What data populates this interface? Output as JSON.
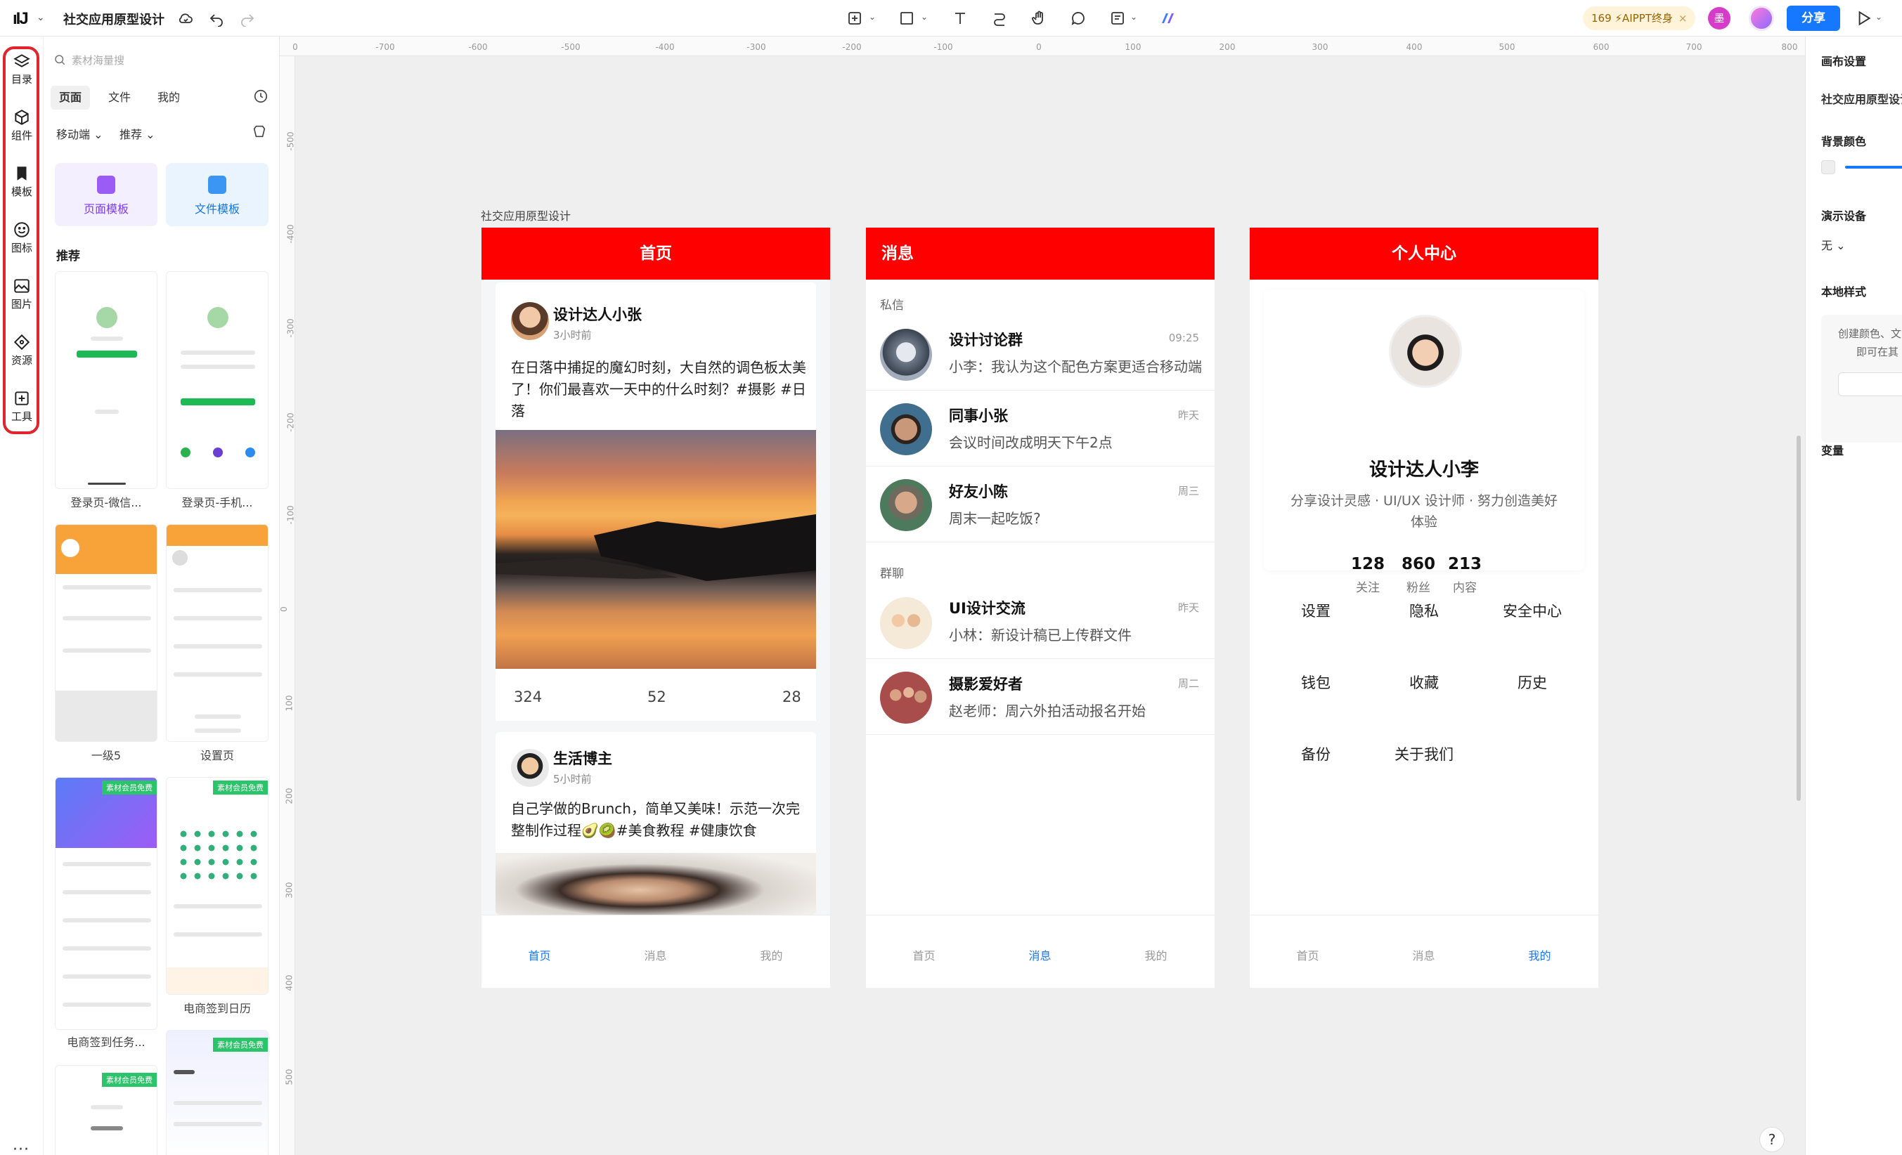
{
  "app": {
    "doc_title": "社交应用原型设计",
    "aippt_label": "169 ⚡AIPPT终身",
    "share_label": "分享",
    "user_badge": "墨"
  },
  "rail": {
    "items": [
      {
        "label": "目录",
        "icon": "layers-icon"
      },
      {
        "label": "组件",
        "icon": "component-icon"
      },
      {
        "label": "模板",
        "icon": "template-icon"
      },
      {
        "label": "图标",
        "icon": "smile-icon"
      },
      {
        "label": "图片",
        "icon": "image-icon"
      },
      {
        "label": "资源",
        "icon": "resource-icon"
      },
      {
        "label": "工具",
        "icon": "tool-icon"
      }
    ],
    "more": "···"
  },
  "left_panel": {
    "search_placeholder": "素材海量搜",
    "tabs": [
      "页面",
      "文件",
      "我的"
    ],
    "filter_platform": "移动端",
    "filter_sort": "推荐",
    "template_cards": [
      "页面模板",
      "文件模板"
    ],
    "section_title": "推荐",
    "thumbs": [
      {
        "caption": "登录页-微信...",
        "tag": ""
      },
      {
        "caption": "登录页-手机...",
        "tag": ""
      },
      {
        "caption": "一级5",
        "tag": ""
      },
      {
        "caption": "设置页",
        "tag": ""
      },
      {
        "caption": "电商签到任务...",
        "tag": "素材会员免费"
      },
      {
        "caption": "电商签到日历",
        "tag": "素材会员免费"
      },
      {
        "caption": "",
        "tag": "素材会员免费"
      },
      {
        "caption": "",
        "tag": "素材会员免费"
      }
    ]
  },
  "ruler": {
    "h_ticks": [
      "0",
      "-700",
      "-600",
      "-500",
      "-400",
      "-300",
      "-200",
      "-100",
      "0",
      "100",
      "200",
      "300",
      "400",
      "500",
      "600",
      "700",
      "800"
    ],
    "v_ticks": [
      "-500",
      "-400",
      "-300",
      "-200",
      "-100",
      "0",
      "100",
      "200",
      "300",
      "400",
      "500"
    ]
  },
  "canvas": {
    "frame_label": "社交应用原型设计"
  },
  "home": {
    "header": "首页",
    "posts": [
      {
        "author": "设计达人小张",
        "time": "3小时前",
        "text": "在日落中捕捉的魔幻时刻，大自然的调色板太美了！你们最喜欢一天中的什么时刻？#摄影 #日落",
        "likes": "324",
        "comments": "52",
        "shares": "28"
      },
      {
        "author": "生活博主",
        "time": "5小时前",
        "text": "自己学做的Brunch，简单又美味！示范一次完整制作过程🥑🥝#美食教程 #健康饮食"
      }
    ]
  },
  "messages": {
    "header": "消息",
    "private_label": "私信",
    "group_label": "群聊",
    "private": [
      {
        "name": "设计讨论群",
        "text": "小李：我认为这个配色方案更适合移动端",
        "time": "09:25"
      },
      {
        "name": "同事小张",
        "text": "会议时间改成明天下午2点",
        "time": "昨天"
      },
      {
        "name": "好友小陈",
        "text": "周末一起吃饭?",
        "time": "周三"
      }
    ],
    "groups": [
      {
        "name": "UI设计交流",
        "text": "小林：新设计稿已上传群文件",
        "time": "昨天"
      },
      {
        "name": "摄影爱好者",
        "text": "赵老师：周六外拍活动报名开始",
        "time": "周二"
      }
    ]
  },
  "profile": {
    "header": "个人中心",
    "name": "设计达人小李",
    "bio": "分享设计灵感 · UI/UX 设计师 · 努力创造美好体验",
    "stats": [
      {
        "num": "128",
        "label": "关注"
      },
      {
        "num": "860",
        "label": "粉丝"
      },
      {
        "num": "213",
        "label": "内容"
      }
    ],
    "menu": [
      "设置",
      "隐私",
      "安全中心",
      "钱包",
      "收藏",
      "历史",
      "备份",
      "关于我们"
    ]
  },
  "tabbar": [
    "首页",
    "消息",
    "我的"
  ],
  "right_panel": {
    "canvas_settings": "画布设置",
    "doc_name": "社交应用原型设计",
    "bg_color_label": "背景颜色",
    "device_label": "演示设备",
    "device_value": "无",
    "local_style_label": "本地样式",
    "local_style_hint_1": "创建颜色、文",
    "local_style_hint_2": "即可在其",
    "variables_label": "变量"
  },
  "colors": {
    "header_red": "#ff0000",
    "accent_blue": "#1677ff",
    "rail_highlight": "#e0252c"
  }
}
